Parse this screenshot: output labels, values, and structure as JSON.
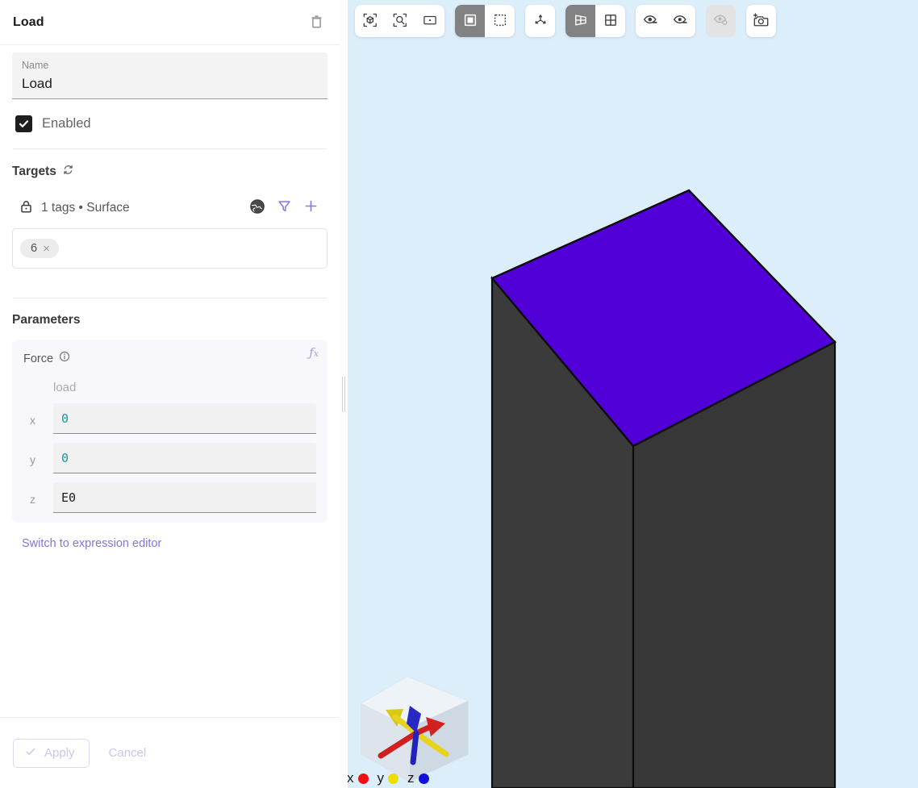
{
  "panel": {
    "title": "Load",
    "delete_icon": "trash-icon",
    "name_field": {
      "label": "Name",
      "value": "Load"
    },
    "enabled": {
      "label": "Enabled",
      "checked": true
    },
    "targets": {
      "title": "Targets",
      "refresh_icon": "refresh-icon",
      "lock_icon": "lock-icon",
      "summary": "1 tags • Surface",
      "actions": [
        "globe-icon",
        "filter-icon",
        "plus-icon"
      ],
      "chips": [
        {
          "label": "6",
          "remove": "×"
        }
      ]
    },
    "parameters": {
      "title": "Parameters",
      "force": {
        "label": "Force",
        "info_icon": "info-icon",
        "fx_icon": "fx-icon",
        "subtitle": "load",
        "components": [
          {
            "axis": "x",
            "value": "0",
            "kind": "number"
          },
          {
            "axis": "y",
            "value": "0",
            "kind": "number"
          },
          {
            "axis": "z",
            "value": "E0",
            "kind": "symbol"
          }
        ]
      },
      "switch_link": "Switch to expression editor"
    },
    "footer": {
      "apply_label": "Apply",
      "apply_icon": "check-icon",
      "cancel_label": "Cancel"
    }
  },
  "viewport": {
    "background_color": "#ddeefb",
    "toolbar": {
      "groups": [
        {
          "name": "view-fit-group",
          "buttons": [
            {
              "name": "fit-object-button",
              "icon": "fit-cube-icon",
              "active": false,
              "enabled": true
            },
            {
              "name": "zoom-to-fit-button",
              "icon": "zoom-search-icon",
              "active": false,
              "enabled": true
            },
            {
              "name": "zoom-region-button",
              "icon": "zoom-region-icon",
              "active": false,
              "enabled": true
            }
          ]
        },
        {
          "name": "selection-mode-group",
          "buttons": [
            {
              "name": "select-single-button",
              "icon": "solid-square-icon",
              "active": true,
              "enabled": true
            },
            {
              "name": "select-box-button",
              "icon": "dashed-square-icon",
              "active": false,
              "enabled": true
            }
          ]
        },
        {
          "name": "axes-group",
          "buttons": [
            {
              "name": "toggle-axes-button",
              "icon": "axes-gizmo-icon",
              "active": false,
              "enabled": true
            }
          ]
        },
        {
          "name": "projection-group",
          "buttons": [
            {
              "name": "perspective-view-button",
              "icon": "perspective-icon",
              "active": true,
              "enabled": true
            },
            {
              "name": "orthographic-view-button",
              "icon": "grid-square-icon",
              "active": false,
              "enabled": true
            }
          ]
        },
        {
          "name": "visibility-group",
          "buttons": [
            {
              "name": "hide-selected-button",
              "icon": "eye-minus-icon",
              "active": false,
              "enabled": true
            },
            {
              "name": "show-all-button",
              "icon": "eye-icon",
              "active": false,
              "enabled": true
            }
          ]
        },
        {
          "name": "clipping-group",
          "buttons": [
            {
              "name": "clip-view-button",
              "icon": "eye-clip-icon",
              "active": false,
              "enabled": false
            }
          ]
        },
        {
          "name": "capture-group",
          "buttons": [
            {
              "name": "add-screenshot-button",
              "icon": "add-camera-icon",
              "active": false,
              "enabled": true
            }
          ]
        }
      ]
    },
    "model": {
      "body_color": "#3b3b3b",
      "selected_face_color": "#5200d8",
      "edge_color": "#0d0d0d"
    },
    "axis_gizmo": {
      "legend": [
        {
          "axis": "x",
          "color": "#ee1111"
        },
        {
          "axis": "y",
          "color": "#eedd00"
        },
        {
          "axis": "z",
          "color": "#1111dd"
        }
      ]
    }
  }
}
